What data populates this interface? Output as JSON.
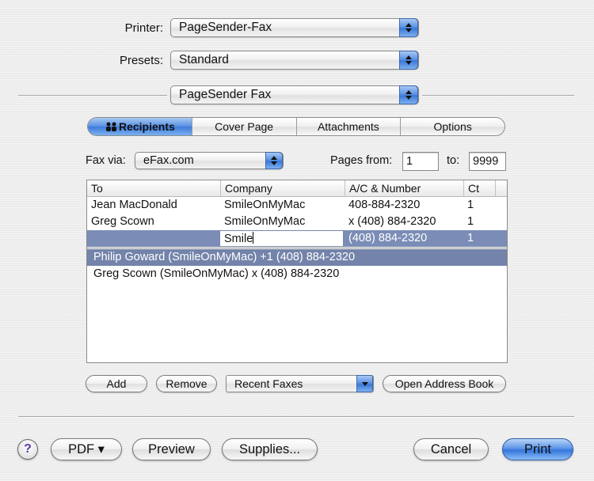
{
  "printer": {
    "label": "Printer:",
    "value": "PageSender-Fax"
  },
  "presets": {
    "label": "Presets:",
    "value": "Standard"
  },
  "panel": {
    "value": "PageSender Fax"
  },
  "tabs": [
    {
      "label": "Recipients",
      "selected": true
    },
    {
      "label": "Cover Page",
      "selected": false
    },
    {
      "label": "Attachments",
      "selected": false
    },
    {
      "label": "Options",
      "selected": false
    }
  ],
  "fax_via": {
    "label": "Fax via:",
    "value": "eFax.com"
  },
  "pages": {
    "from_label": "Pages from:",
    "from_value": "1",
    "to_label": "to:",
    "to_value": "9999"
  },
  "table": {
    "columns": [
      "To",
      "Company",
      "A/C & Number",
      "Ct"
    ],
    "rows": [
      {
        "to": "Jean MacDonald",
        "company": "SmileOnMyMac",
        "number": "408-884-2320",
        "ct": "1"
      },
      {
        "to": "Greg Scown",
        "company": "SmileOnMyMac",
        "number": "x (408) 884-2320",
        "ct": "1"
      },
      {
        "to": "",
        "company": "Smile",
        "number": "(408) 884-2320",
        "ct": "1"
      }
    ],
    "suggestions": [
      "Philip Goward (SmileOnMyMac) +1 (408) 884-2320",
      "Greg Scown (SmileOnMyMac) x (408) 884-2320"
    ]
  },
  "buttons": {
    "add": "Add",
    "remove": "Remove",
    "recent_faxes": "Recent Faxes",
    "open_address_book": "Open Address Book",
    "help": "?",
    "pdf": "PDF ▾",
    "preview": "Preview",
    "supplies": "Supplies...",
    "cancel": "Cancel",
    "print": "Print"
  },
  "colors": {
    "accent": "#3b78d8",
    "row_highlight": "#7b8db6"
  }
}
